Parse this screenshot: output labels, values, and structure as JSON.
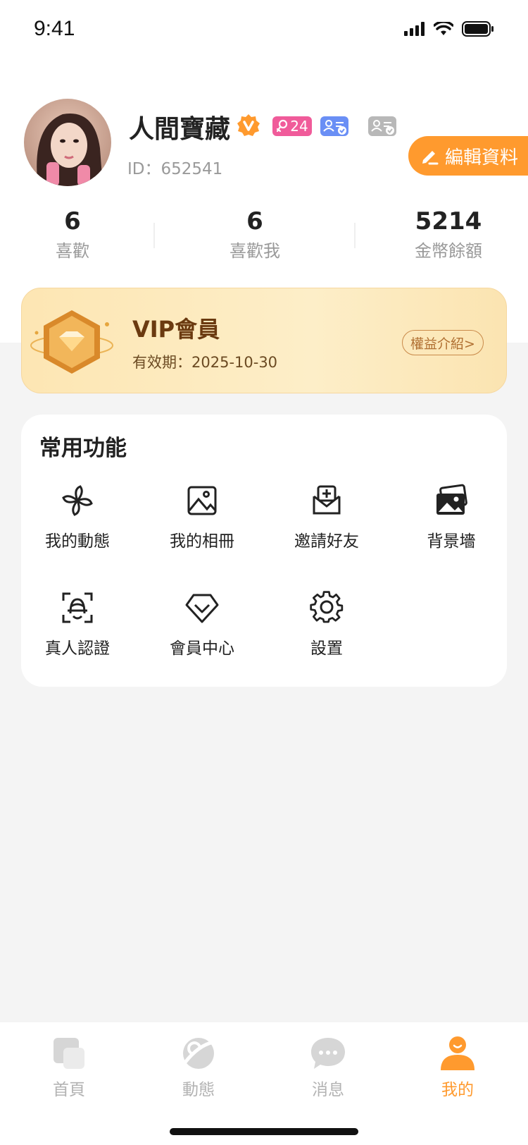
{
  "status_bar": {
    "time": "9:41"
  },
  "profile": {
    "name": "人間寶藏",
    "age": "24",
    "id_text": "ID：652541",
    "edit_label": "編輯資料"
  },
  "stats": [
    {
      "value": "6",
      "label": "喜歡"
    },
    {
      "value": "6",
      "label": "喜歡我"
    },
    {
      "value": "5214",
      "label": "金幣餘額"
    }
  ],
  "vip": {
    "title": "VIP會員",
    "expiry": "有效期：2025-10-30",
    "benefits_label": "權益介紹>"
  },
  "functions": {
    "title": "常用功能",
    "items": [
      {
        "label": "我的動態",
        "icon": "pinwheel-icon"
      },
      {
        "label": "我的相冊",
        "icon": "image-icon"
      },
      {
        "label": "邀請好友",
        "icon": "mail-plus-icon"
      },
      {
        "label": "背景墻",
        "icon": "photos-icon"
      },
      {
        "label": "真人認證",
        "icon": "face-scan-icon"
      },
      {
        "label": "會員中心",
        "icon": "diamond-icon"
      },
      {
        "label": "設置",
        "icon": "gear-icon"
      }
    ]
  },
  "tabbar": {
    "items": [
      {
        "label": "首頁",
        "icon": "home-cards-icon",
        "active": false
      },
      {
        "label": "動態",
        "icon": "planet-icon",
        "active": false
      },
      {
        "label": "消息",
        "icon": "chat-bubble-icon",
        "active": false
      },
      {
        "label": "我的",
        "icon": "person-icon",
        "active": true
      }
    ]
  },
  "colors": {
    "accent": "#ff9a2e",
    "vip_text": "#6b3a10",
    "age_badge": "#f05b9a",
    "real_badge": "#6a8ff5"
  }
}
